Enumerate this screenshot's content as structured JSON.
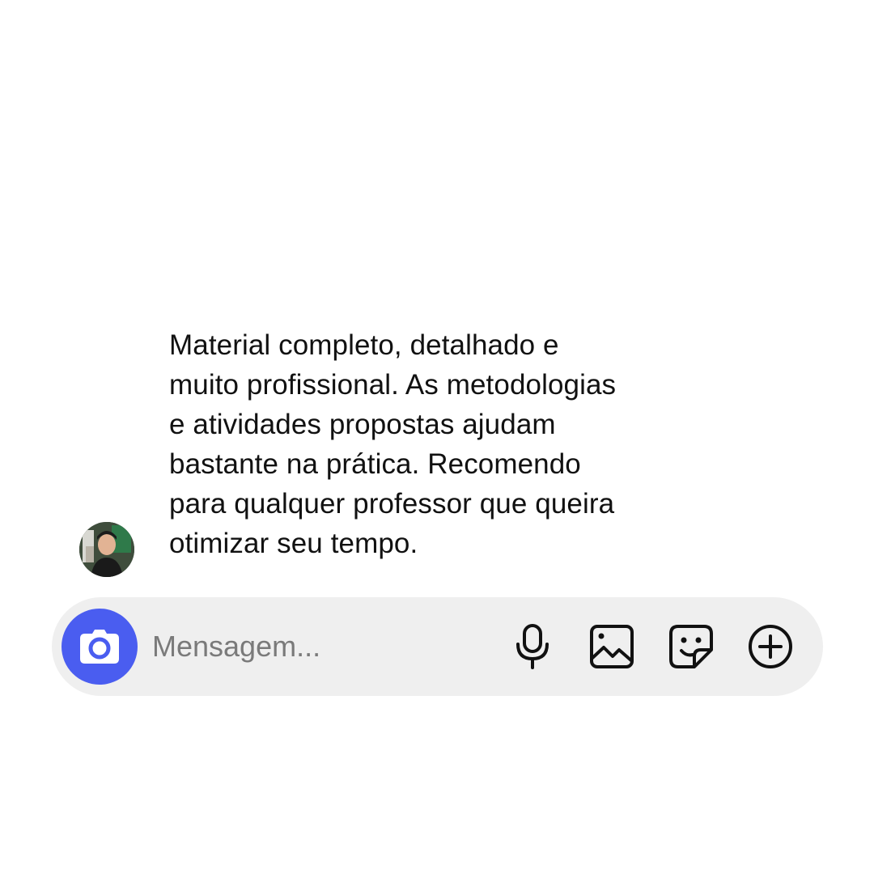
{
  "conversation": {
    "message": {
      "lines": [
        "Material completo, detalhado e",
        "muito profissional. As metodologias",
        "e atividades propostas ajudam",
        "bastante na prática. Recomendo",
        "para qualquer professor que queira",
        "otimizar seu tempo."
      ]
    }
  },
  "composer": {
    "placeholder": "Mensagem...",
    "accent_color": "#4a5df0",
    "icons": [
      "camera-icon",
      "microphone-icon",
      "gallery-icon",
      "sticker-icon",
      "plus-icon"
    ]
  }
}
